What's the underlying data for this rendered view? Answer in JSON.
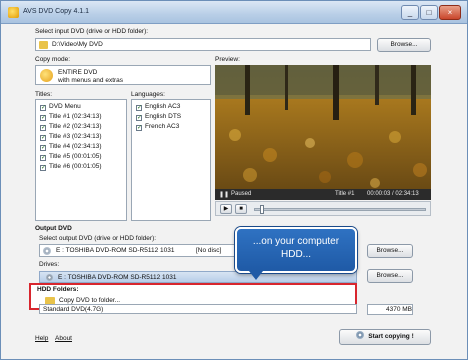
{
  "window": {
    "title": "AVS DVD Copy 4.1.1",
    "min_glyph": "_",
    "max_glyph": "□",
    "close_glyph": "×"
  },
  "input": {
    "label": "Select input DVD (drive or HDD folder):",
    "path": "D:\\Video\\My DVD",
    "browse_label": "Browse..."
  },
  "copy_mode": {
    "label": "Copy mode:",
    "line1": "ENTIRE DVD",
    "line2": "with menus and extras"
  },
  "titles": {
    "label": "Titles:",
    "items": [
      "DVD Menu",
      "Title #1 (02:34:13)",
      "Title #2 (02:34:13)",
      "Title #3 (02:34:13)",
      "Title #4 (02:34:13)",
      "Title #5 (00:01:05)",
      "Title #6 (00:01:05)"
    ]
  },
  "languages": {
    "label": "Languages:",
    "items": [
      "English AC3",
      "English DTS",
      "French AC3"
    ]
  },
  "preview": {
    "label": "Preview:",
    "status": "Paused",
    "title_no": "Title #1",
    "time": "00:00:03 / 02:34:13",
    "play_glyph": "▶",
    "stop_glyph": "■",
    "progress": 0.03
  },
  "output": {
    "section": "Output DVD",
    "select_label": "Select output DVD (drive or HDD folder):",
    "drive_text": "E : TOSHIBA  DVD-ROM SD-R5112 1031",
    "disc_state": "[No disc]",
    "browse_label": "Browse...",
    "drives_label": "Drives:",
    "drive_item": "E : TOSHIBA  DVD-ROM SD-R5112 1031",
    "hdd_label": "HDD Folders:",
    "hdd_item": "Copy DVD to folder...",
    "format": "Standard DVD(4.7G)",
    "size": "4370 MB"
  },
  "callout": {
    "line1": "...on your computer",
    "line2": "HDD..."
  },
  "footer": {
    "help": "Help",
    "about": "About",
    "start": "Start copying !"
  },
  "colors": {
    "accent_blue": "#1f5aa6",
    "highlight_red": "#d8262e"
  }
}
